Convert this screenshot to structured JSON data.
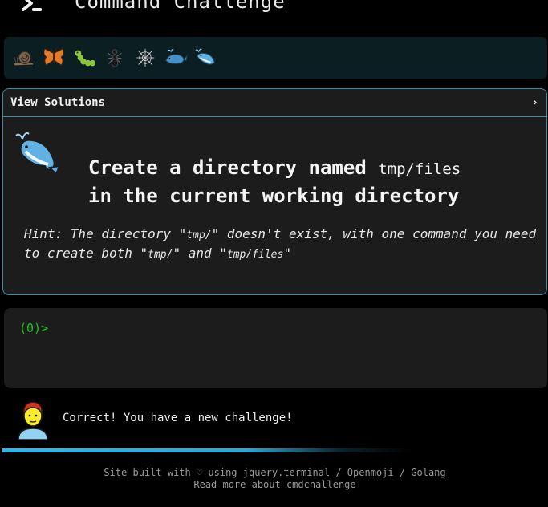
{
  "header": {
    "title": "Command Challenge",
    "logo_icon": "terminal-prompt-icon"
  },
  "levels": [
    {
      "name": "snail",
      "icon": "snail-icon"
    },
    {
      "name": "butterfly",
      "icon": "butterfly-icon"
    },
    {
      "name": "caterpillar",
      "icon": "caterpillar-icon"
    },
    {
      "name": "ant",
      "icon": "ant-icon"
    },
    {
      "name": "spider-web",
      "icon": "spider-web-icon"
    },
    {
      "name": "whale",
      "icon": "whale-icon"
    },
    {
      "name": "spouting-whale",
      "icon": "spouting-whale-icon"
    }
  ],
  "challenge": {
    "solutions_label": "View Solutions",
    "chevron": "›",
    "title_part1": "Create a directory named ",
    "title_code": "tmp/files",
    "title_part2": "in the current working directory",
    "hint_prefix": "Hint: The directory \"",
    "hint_code1": "tmp/",
    "hint_mid1": "\" doesn't exist, with one command you need to create both \"",
    "hint_code2": "tmp/",
    "hint_mid2": "\" and \"",
    "hint_code3": "tmp/files",
    "hint_suffix": "\""
  },
  "terminal": {
    "prompt": "(0)>"
  },
  "status": {
    "message": "Correct! You have a new challenge!",
    "avatar_icon": "man-avatar-icon"
  },
  "footer": {
    "line1": "Site built with ♡ using jquery.terminal / Openmoji / Golang",
    "line2": "Read more about cmdchallenge"
  },
  "colors": {
    "accent": "#2f8fb0",
    "prompt": "#18c718",
    "panel_bg": "#1c1c1c",
    "level_bar_bg": "#0b1e22"
  }
}
